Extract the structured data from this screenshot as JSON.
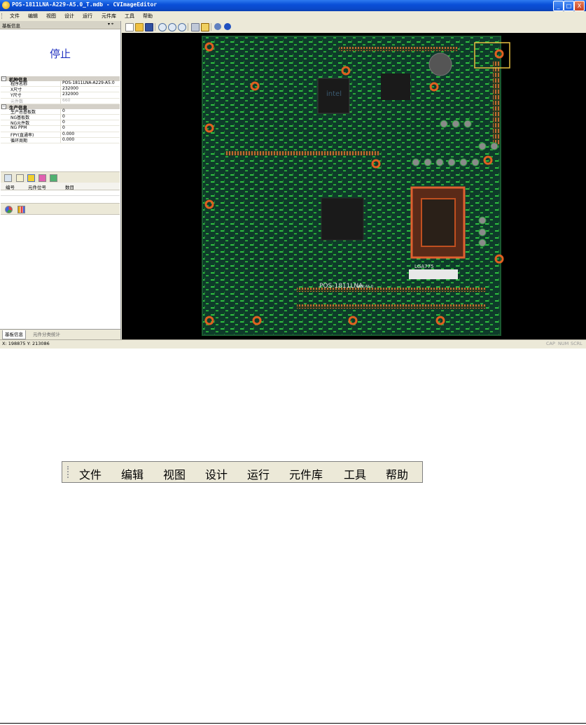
{
  "window": {
    "title": "POS-1811LNA-A229-A5.0_T.mdb - CVImageEditor",
    "controls": [
      "_",
      "□",
      "X"
    ]
  },
  "menu": [
    "文件",
    "编辑",
    "视图",
    "设计",
    "运行",
    "元件库",
    "工具",
    "帮助"
  ],
  "left_panel": {
    "title": "基板信息",
    "pin": "▾ ⌖",
    "status": "停止",
    "sections": [
      {
        "label": "机种信息",
        "rows": [
          {
            "k": "程序名称",
            "v": "POS-1811LNA-A229-A5.0"
          },
          {
            "k": "X尺寸",
            "v": "232000"
          },
          {
            "k": "Y尺寸",
            "v": "232000"
          },
          {
            "k": "元件数",
            "v": "660",
            "dim": true
          }
        ]
      },
      {
        "label": "生产信息",
        "rows": [
          {
            "k": "生产总基板数",
            "v": "0"
          },
          {
            "k": "NG基板数",
            "v": "0"
          },
          {
            "k": "NG元件数",
            "v": "0"
          },
          {
            "k": "NG PPM",
            "v": "0"
          },
          {
            "k": "FPY(直通率)",
            "v": "0.000"
          },
          {
            "k": "循环周期",
            "v": "0.000"
          }
        ]
      }
    ],
    "grid_columns": [
      "编号",
      "元件位号",
      "数目"
    ],
    "tabs": [
      "基板信息",
      "元件分类统计"
    ]
  },
  "statusbar": {
    "coords": "X: 198875 Y: 213086",
    "indicators": [
      "CAP",
      "NUM",
      "SCRL"
    ]
  },
  "pcb": {
    "silk_label_1": "POS-1811LNA",
    "silk_label_2": "VER:A5.0",
    "silk_label_3": "LGA775",
    "chip_brand": "intel"
  },
  "colors": {
    "titlebar": "#0a50d8",
    "chrome": "#ece9d8",
    "status_text": "#1e2fc0",
    "viewport_bg": "#000000",
    "pcb_base": "#0e3b2a",
    "highlight": "#e8c040"
  }
}
